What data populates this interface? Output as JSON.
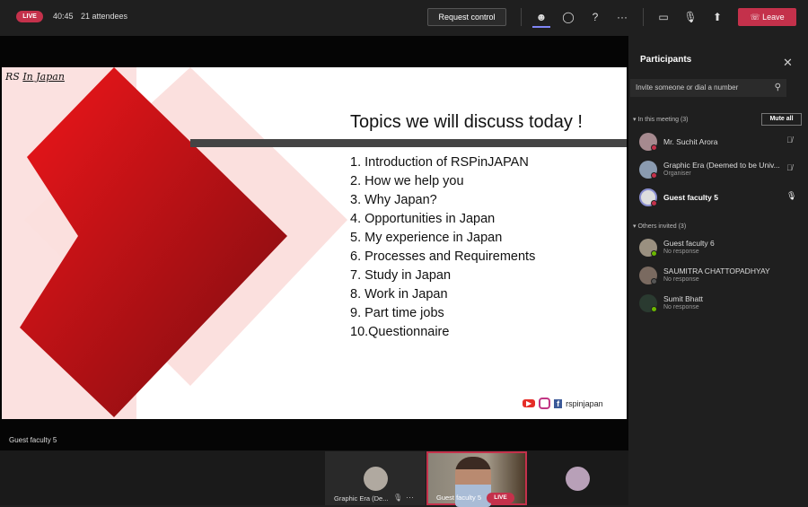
{
  "topbar": {
    "live": "LIVE",
    "time": "40:45",
    "attendees": "21 attendees",
    "request_control": "Request control",
    "leave": "Leave",
    "leave_color": "#c4314b"
  },
  "slide": {
    "title": "Topics we will discuss today !",
    "logo_text": "RS In Japan",
    "topics": [
      "1.  Introduction of RSPinJAPAN",
      "2.  How we help you",
      "3.  Why Japan?",
      "4.  Opportunities in Japan",
      "5.  My experience in Japan",
      "6.  Processes and Requirements",
      "7.  Study in Japan",
      "8.  Work in Japan",
      "9.  Part time jobs",
      "10.Questionnaire"
    ],
    "social_handle": "rspinjapan"
  },
  "stage": {
    "presenter": "Guest faculty 5"
  },
  "panel": {
    "title": "Participants",
    "invite_placeholder": "Invite someone or dial a number",
    "in_meeting": "In this meeting (3)",
    "mute_all": "Mute all",
    "others": "Others invited (3)",
    "meeting": [
      {
        "name": "Mr. Suchit Arora",
        "sub": ""
      },
      {
        "name": "Graphic Era (Deemed to be Univ...",
        "sub": "Organiser"
      },
      {
        "name": "Guest faculty 5",
        "sub": ""
      }
    ],
    "invited": [
      {
        "name": "Guest faculty 6",
        "sub": "No response"
      },
      {
        "name": "SAUMITRA CHATTOPADHYAY",
        "sub": "No response"
      },
      {
        "name": "Sumit Bhatt",
        "sub": "No response"
      }
    ]
  },
  "tiles": {
    "t1": "Graphic Era (De...",
    "t2": "Guest faculty 5",
    "live": "LIVE"
  }
}
